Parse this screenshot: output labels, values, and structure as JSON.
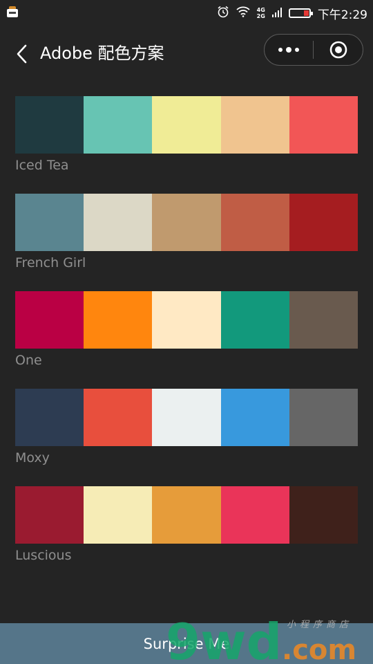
{
  "status_bar": {
    "time": "下午2:29",
    "network_top": "4G",
    "network_bottom": "2G",
    "battery_color": "#e53935"
  },
  "navbar": {
    "title": "Adobe 配色方案",
    "back_icon": "chevron-left-icon",
    "more_icon": "more-dots-icon",
    "close_icon": "target-circle-icon"
  },
  "palettes": [
    {
      "name": "Iced Tea",
      "colors": [
        "#1f3a40",
        "#67c4b3",
        "#f0ec96",
        "#f0c48f",
        "#f25656"
      ]
    },
    {
      "name": "French Girl",
      "colors": [
        "#5a8590",
        "#dcd8c6",
        "#c09a6e",
        "#c05d45",
        "#a51d20"
      ]
    },
    {
      "name": "One",
      "colors": [
        "#ba0044",
        "#ff860e",
        "#ffe9c4",
        "#12997c",
        "#695a4e"
      ]
    },
    {
      "name": "Moxy",
      "colors": [
        "#2d3c52",
        "#e84f3d",
        "#ebf0f0",
        "#3899dd",
        "#666666"
      ]
    },
    {
      "name": "Luscious",
      "colors": [
        "#9a1b30",
        "#f6ecb6",
        "#e69c3a",
        "#ea3459",
        "#3f211b"
      ]
    }
  ],
  "bottom": {
    "button_label": "Surprise Me",
    "button_color": "#557589"
  },
  "watermark": {
    "text": "9wd",
    "suffix": ".com",
    "tagline": "小程序商店"
  }
}
